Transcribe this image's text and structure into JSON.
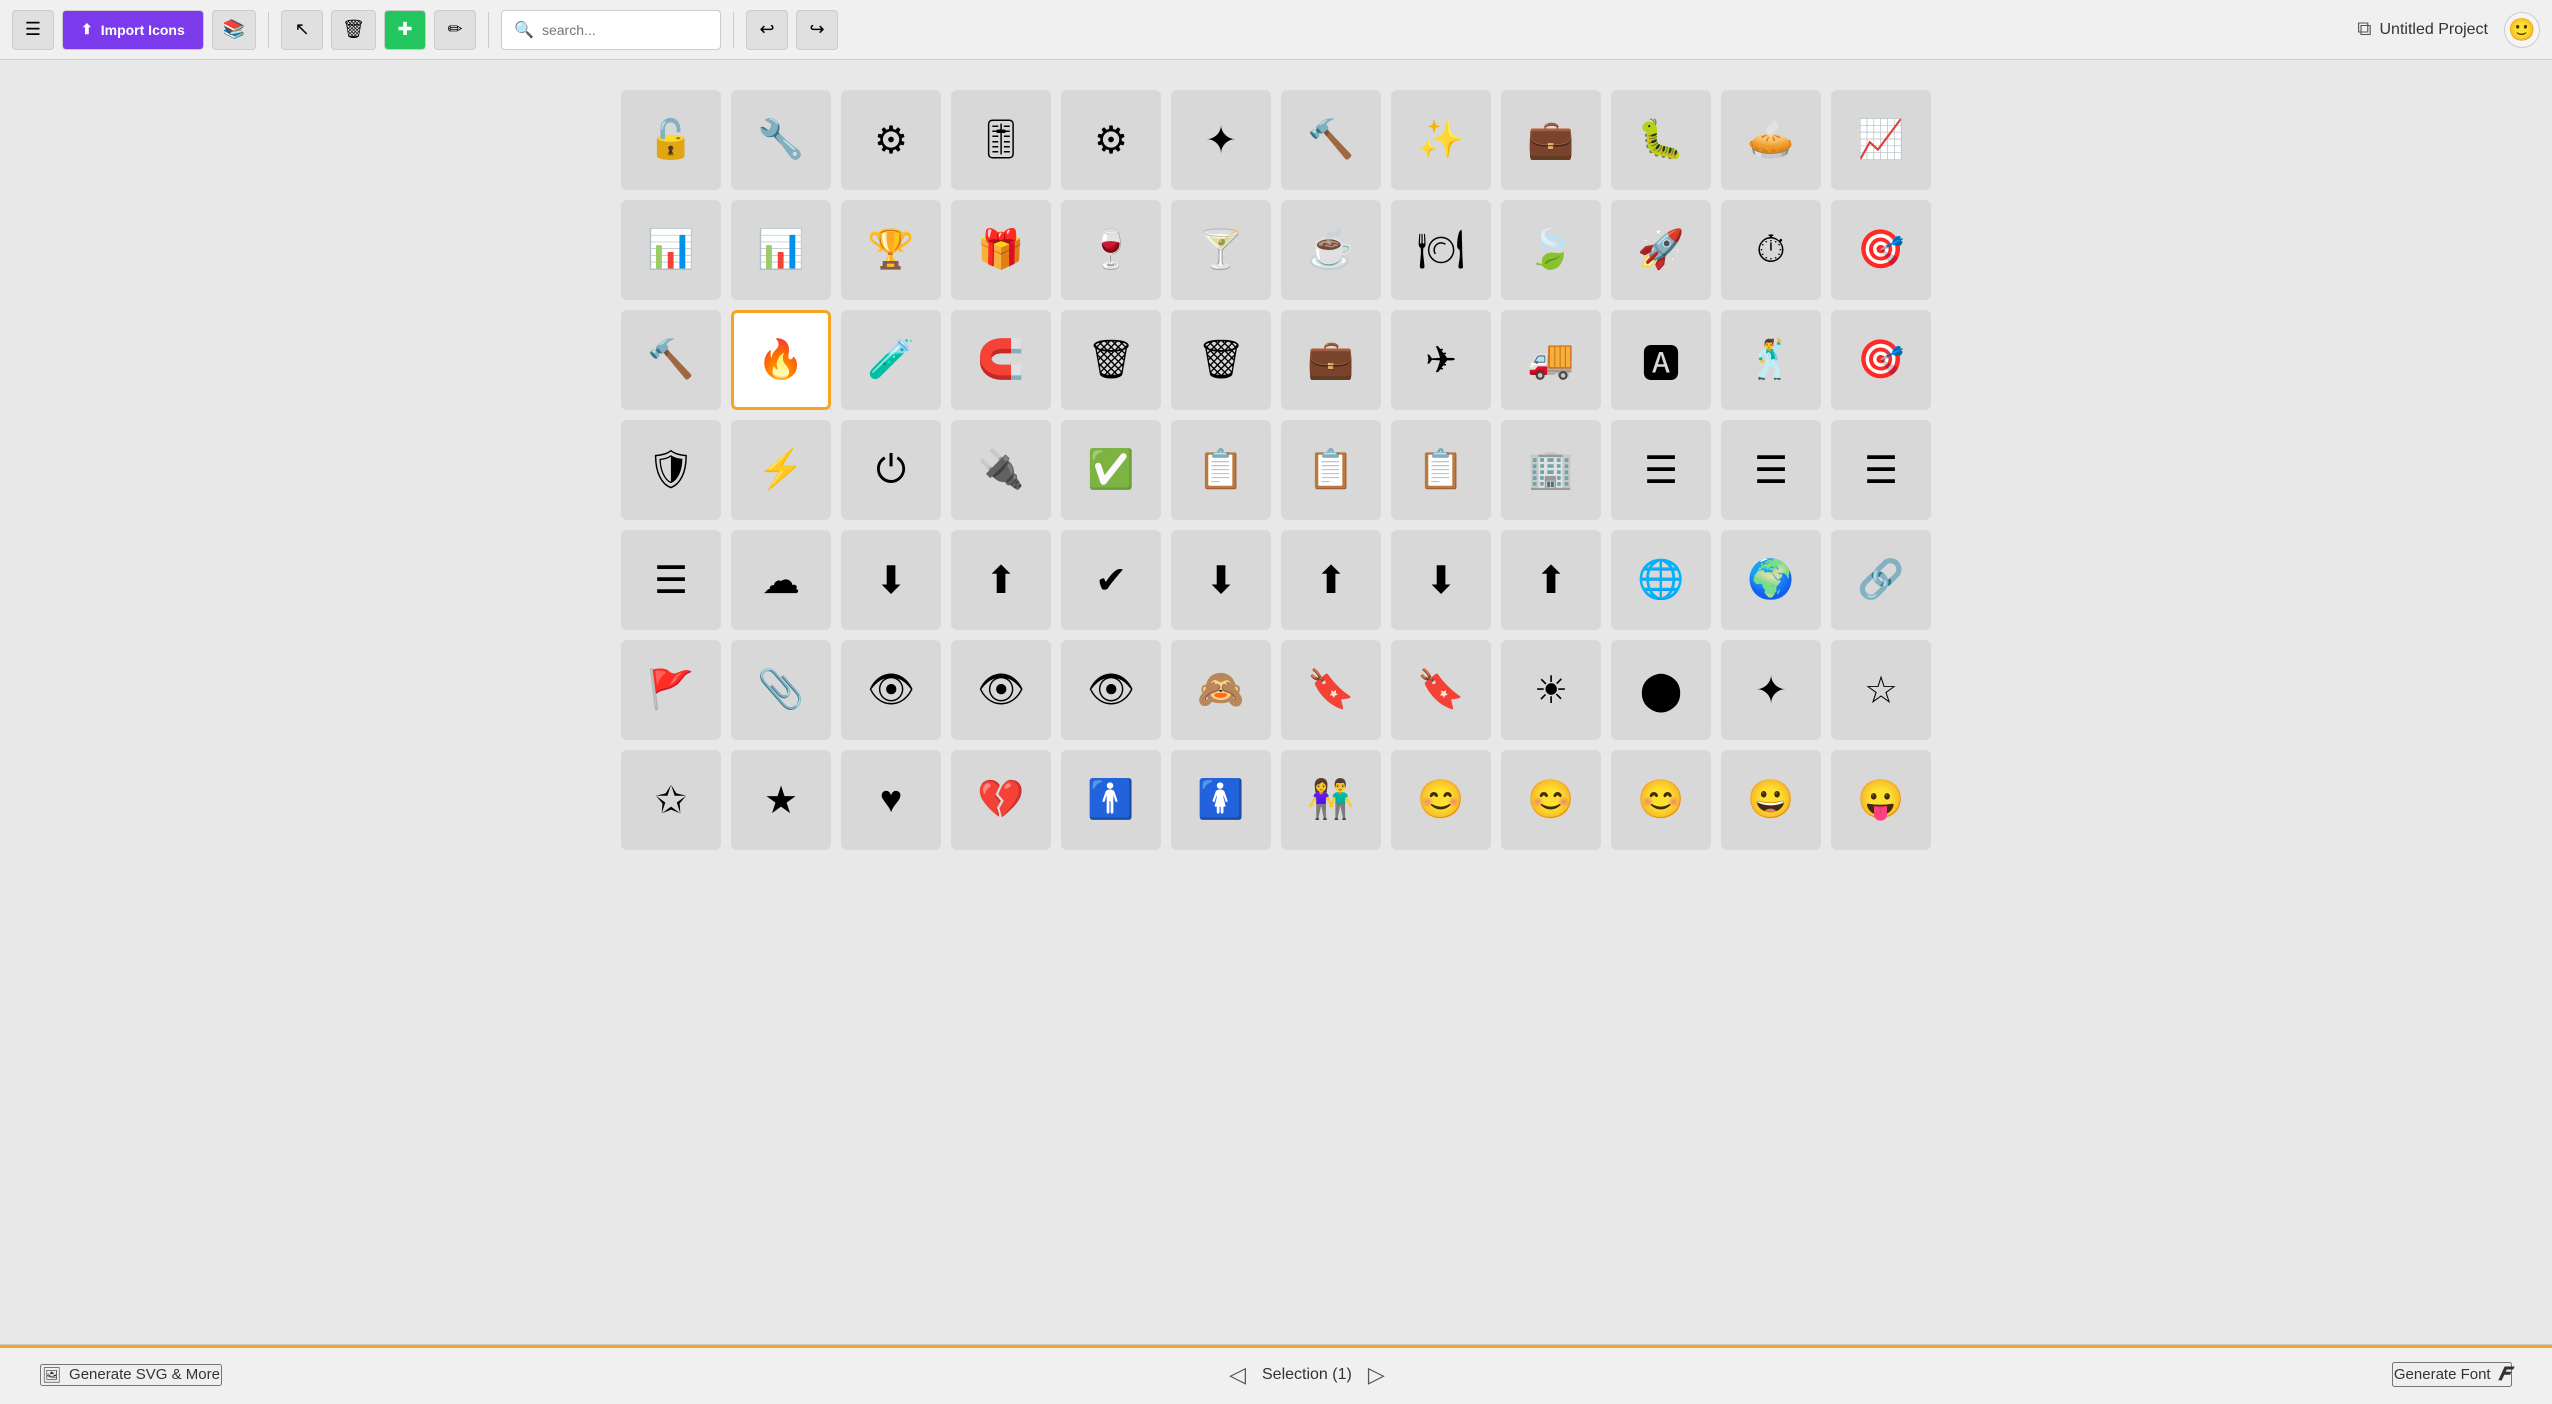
{
  "toolbar": {
    "import_label": "Import Icons",
    "search_placeholder": "search...",
    "project_name": "Untitled Project",
    "undo_label": "undo",
    "redo_label": "redo"
  },
  "bottom": {
    "generate_svg_label": "Generate SVG & More",
    "selection_label": "Selection (1)",
    "generate_font_label": "Generate Font"
  },
  "icons": [
    {
      "id": "row1",
      "cells": [
        {
          "sym": "🔓",
          "name": "unlock"
        },
        {
          "sym": "🔧",
          "name": "wrench"
        },
        {
          "sym": "⚙",
          "name": "sliders"
        },
        {
          "sym": "🎚",
          "name": "faders"
        },
        {
          "sym": "⚙",
          "name": "gear"
        },
        {
          "sym": "✦",
          "name": "gear-outline"
        },
        {
          "sym": "🔨",
          "name": "hammer"
        },
        {
          "sym": "✨",
          "name": "magic-wand"
        },
        {
          "sym": "💼",
          "name": "first-aid"
        },
        {
          "sym": "🐛",
          "name": "bug"
        },
        {
          "sym": "🥧",
          "name": "pie-chart"
        },
        {
          "sym": "📈",
          "name": "line-chart"
        }
      ]
    },
    {
      "id": "row2",
      "cells": [
        {
          "sym": "📊",
          "name": "bar-chart"
        },
        {
          "sym": "📊",
          "name": "bar-chart2"
        },
        {
          "sym": "🏆",
          "name": "trophy"
        },
        {
          "sym": "🎁",
          "name": "gift"
        },
        {
          "sym": "🍷",
          "name": "wine"
        },
        {
          "sym": "🍸",
          "name": "cocktail"
        },
        {
          "sym": "☕",
          "name": "mug"
        },
        {
          "sym": "🍽",
          "name": "cutlery"
        },
        {
          "sym": "🍃",
          "name": "leaf"
        },
        {
          "sym": "🚀",
          "name": "rocket"
        },
        {
          "sym": "⏱",
          "name": "speedometer"
        },
        {
          "sym": "🎯",
          "name": "target"
        }
      ]
    },
    {
      "id": "row3",
      "cells": [
        {
          "sym": "🔨",
          "name": "gavel"
        },
        {
          "sym": "🔥",
          "name": "fire",
          "selected": true
        },
        {
          "sym": "🧪",
          "name": "flask"
        },
        {
          "sym": "🧲",
          "name": "magnet"
        },
        {
          "sym": "🗑",
          "name": "trash"
        },
        {
          "sym": "🗑",
          "name": "trash2"
        },
        {
          "sym": "💼",
          "name": "briefcase"
        },
        {
          "sym": "✈",
          "name": "plane"
        },
        {
          "sym": "🚚",
          "name": "truck"
        },
        {
          "sym": "🅰",
          "name": "text-size"
        },
        {
          "sym": "🕺",
          "name": "figure"
        },
        {
          "sym": "🎯",
          "name": "crosshair"
        }
      ]
    },
    {
      "id": "row4",
      "cells": [
        {
          "sym": "🛡",
          "name": "shield-down"
        },
        {
          "sym": "⚡",
          "name": "lightning"
        },
        {
          "sym": "⏻",
          "name": "power"
        },
        {
          "sym": "🔌",
          "name": "unplug"
        },
        {
          "sym": "✅",
          "name": "checklist"
        },
        {
          "sym": "📋",
          "name": "list-numbered"
        },
        {
          "sym": "📋",
          "name": "list-bullet"
        },
        {
          "sym": "📋",
          "name": "list-arrow"
        },
        {
          "sym": "🏢",
          "name": "org-chart"
        },
        {
          "sym": "☰",
          "name": "menu"
        },
        {
          "sym": "☰",
          "name": "menu-center"
        },
        {
          "sym": "☰",
          "name": "menu-right"
        }
      ]
    },
    {
      "id": "row5",
      "cells": [
        {
          "sym": "☰",
          "name": "menu-up"
        },
        {
          "sym": "☁",
          "name": "cloud"
        },
        {
          "sym": "⬇",
          "name": "cloud-download"
        },
        {
          "sym": "⬆",
          "name": "cloud-upload"
        },
        {
          "sym": "✔",
          "name": "cloud-check"
        },
        {
          "sym": "⬇",
          "name": "download-tray"
        },
        {
          "sym": "⬆",
          "name": "upload-tray"
        },
        {
          "sym": "⬇",
          "name": "download-alt"
        },
        {
          "sym": "⬆",
          "name": "upload-alt"
        },
        {
          "sym": "🌐",
          "name": "globe"
        },
        {
          "sym": "🌍",
          "name": "globe2"
        },
        {
          "sym": "🔗",
          "name": "link"
        }
      ]
    },
    {
      "id": "row6",
      "cells": [
        {
          "sym": "🚩",
          "name": "flag"
        },
        {
          "sym": "📎",
          "name": "paperclip"
        },
        {
          "sym": "👁",
          "name": "eye"
        },
        {
          "sym": "👁",
          "name": "eye-plus"
        },
        {
          "sym": "👁",
          "name": "eye-refresh"
        },
        {
          "sym": "🙈",
          "name": "eye-slash"
        },
        {
          "sym": "🔖",
          "name": "bookmark"
        },
        {
          "sym": "🔖",
          "name": "bookmark-open"
        },
        {
          "sym": "☀",
          "name": "sun"
        },
        {
          "sym": "⬤",
          "name": "half-circle"
        },
        {
          "sym": "✦",
          "name": "sun-alt"
        },
        {
          "sym": "☆",
          "name": "star-empty"
        }
      ]
    },
    {
      "id": "row7",
      "cells": [
        {
          "sym": "✩",
          "name": "star-half"
        },
        {
          "sym": "★",
          "name": "star"
        },
        {
          "sym": "♥",
          "name": "heart"
        },
        {
          "sym": "💔",
          "name": "heart-broken"
        },
        {
          "sym": "🚹",
          "name": "person-male"
        },
        {
          "sym": "🚺",
          "name": "person-female"
        },
        {
          "sym": "👫",
          "name": "couple"
        },
        {
          "sym": "😊",
          "name": "smile"
        },
        {
          "sym": "😊",
          "name": "smile2"
        },
        {
          "sym": "😊",
          "name": "smile3"
        },
        {
          "sym": "😀",
          "name": "smile4"
        },
        {
          "sym": "😛",
          "name": "tongue"
        }
      ]
    }
  ]
}
